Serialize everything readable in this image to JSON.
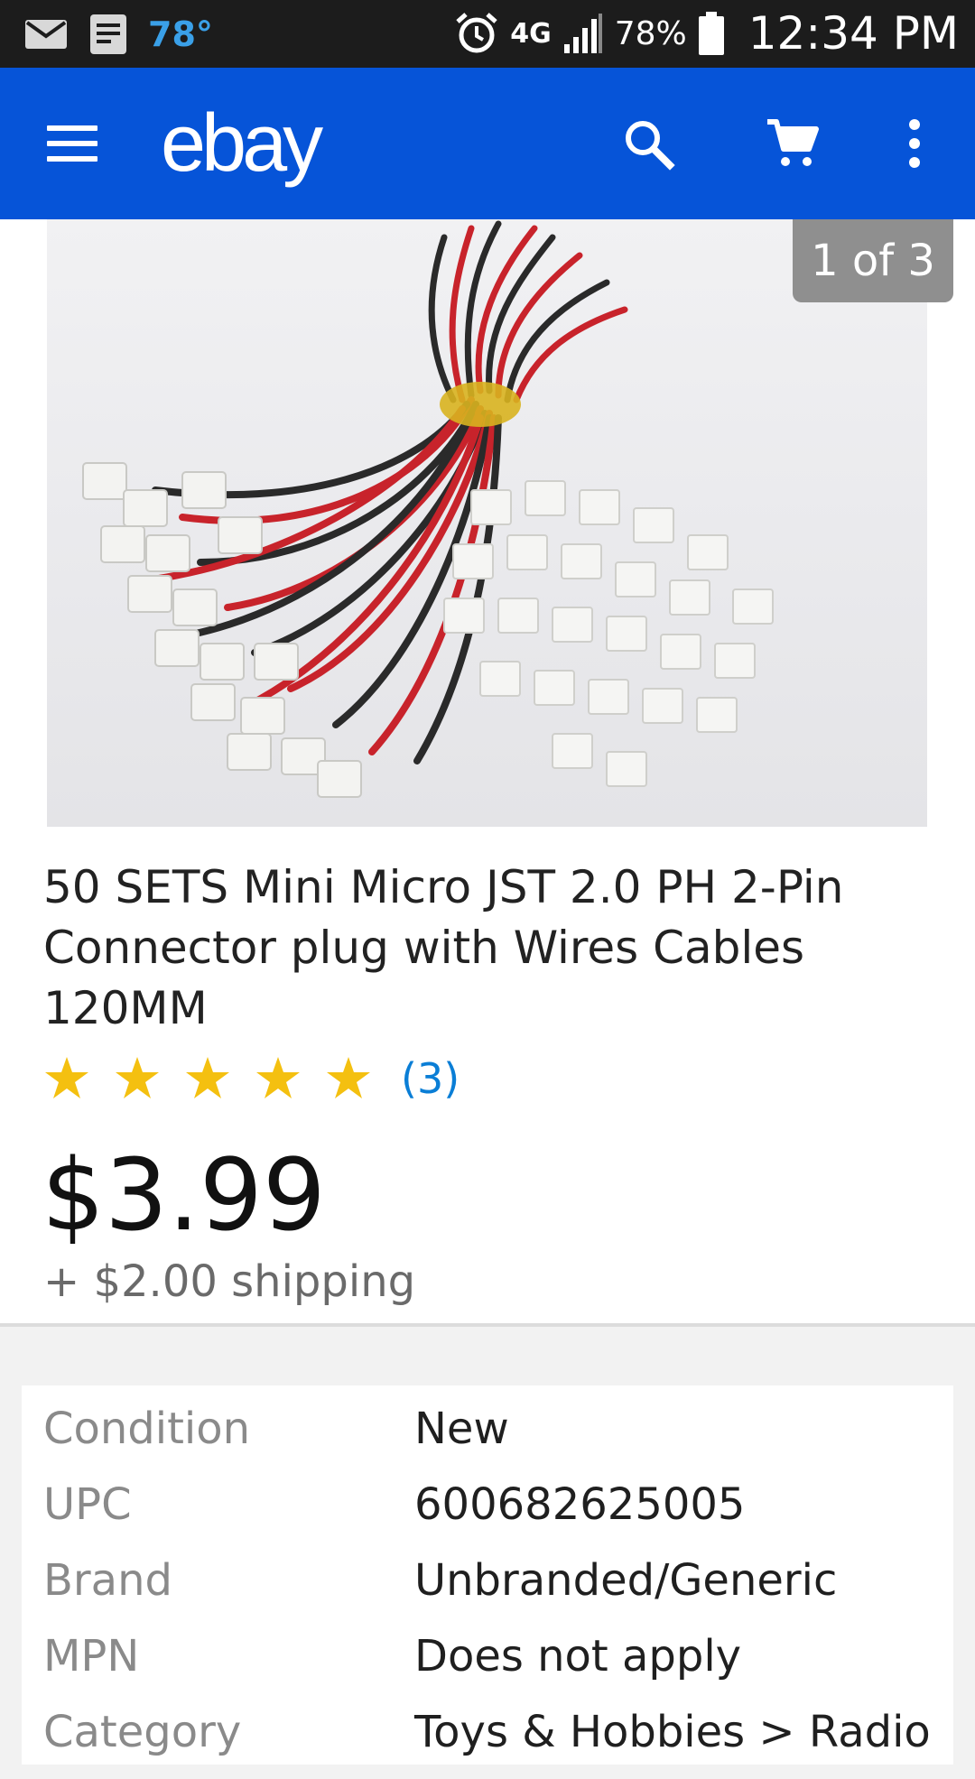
{
  "status_bar": {
    "temperature": "78°",
    "network": "4G",
    "battery": "78%",
    "time": "12:34 PM"
  },
  "header": {
    "logo": "ebay",
    "icons": [
      "menu-icon",
      "search-icon",
      "cart-icon",
      "more-vert-icon"
    ]
  },
  "gallery": {
    "counter": "1 of 3"
  },
  "product": {
    "title": "50 SETS Mini Micro JST 2.0 PH 2-Pin Connector plug with Wires Cables 120MM",
    "rating_stars": 5,
    "review_count": "(3)",
    "price": "$3.99",
    "shipping": "+ $2.00 shipping"
  },
  "specs": [
    {
      "label": "Condition",
      "value": "New"
    },
    {
      "label": "UPC",
      "value": "600682625005"
    },
    {
      "label": "Brand",
      "value": "Unbranded/Generic"
    },
    {
      "label": "MPN",
      "value": "Does not apply"
    },
    {
      "label": "Category",
      "value": "Toys & Hobbies > Radio"
    }
  ],
  "colors": {
    "brand_blue": "#0654d8",
    "star_yellow": "#f4c010",
    "link_blue": "#0a7ed6"
  }
}
